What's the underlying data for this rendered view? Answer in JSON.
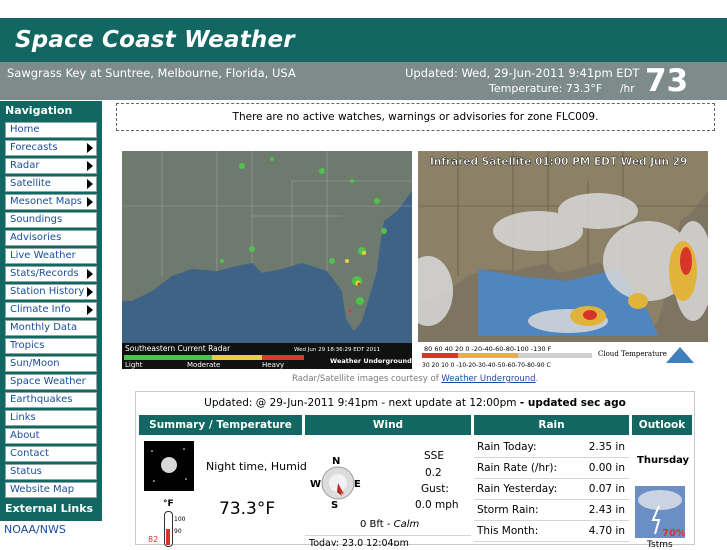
{
  "header": {
    "site_title": "Space Coast Weather",
    "location": "Sawgrass Key at Suntree, Melbourne, Florida, USA",
    "updated": "Updated:  Wed, 29-Jun-2011 9:41pm EDT",
    "temperature_line": "Temperature: 73.3°F",
    "temperature_rate_unit": "/hr",
    "temperature_big": "73 °F"
  },
  "sidebar": {
    "nav_heading": "Navigation",
    "items": [
      {
        "label": "Home",
        "submenu": false
      },
      {
        "label": "Forecasts",
        "submenu": true
      },
      {
        "label": "Radar",
        "submenu": true
      },
      {
        "label": "Satellite",
        "submenu": true
      },
      {
        "label": "Mesonet Maps",
        "submenu": true
      },
      {
        "label": "Soundings",
        "submenu": false
      },
      {
        "label": "Advisories",
        "submenu": false
      },
      {
        "label": "Live Weather",
        "submenu": false
      },
      {
        "label": "Stats/Records",
        "submenu": true
      },
      {
        "label": "Station History",
        "submenu": true
      },
      {
        "label": "Climate Info",
        "submenu": true
      },
      {
        "label": "Monthly Data",
        "submenu": false
      },
      {
        "label": "Tropics",
        "submenu": false
      },
      {
        "label": "Sun/Moon",
        "submenu": false
      },
      {
        "label": "Space Weather",
        "submenu": false
      },
      {
        "label": "Earthquakes",
        "submenu": false
      },
      {
        "label": "Links",
        "submenu": false
      },
      {
        "label": "About",
        "submenu": false
      },
      {
        "label": "Contact",
        "submenu": false
      },
      {
        "label": "Status",
        "submenu": false
      },
      {
        "label": "Website Map",
        "submenu": false
      }
    ],
    "external_heading": "External Links",
    "external_items": [
      "NOAA/NWS"
    ]
  },
  "advisory": "There are no active watches, warnings or advisories for zone FLC009.",
  "radar": {
    "title": "Southeastern Current Radar",
    "timestamp": "Wed Jun 29 18:36:29 EDT 2011",
    "legend": [
      "Light",
      "Moderate",
      "Heavy"
    ],
    "brand": "Weather Underground"
  },
  "satellite": {
    "title": "Infrared Satellite 01:00 PM EDT Wed Jun 29",
    "scale_top": "80  60  40  20   0  -20-40-60-80-100  -130  F",
    "scale_bottom": "30 20 10  0 -10-20-30-40-50-60-70-80-90  C",
    "legend_label": "Cloud Temperature"
  },
  "credit": {
    "prefix": "Radar/Satellite images courtesy of ",
    "link": "Weather Underground",
    "suffix": "."
  },
  "current": {
    "updated_line": "Updated: @ 29-Jun-2011 9:41pm - next update at 12:00pm",
    "updated_suffix": "- updated sec ago",
    "columns": [
      "Summary / Temperature",
      "Wind",
      "Rain",
      "Outlook"
    ],
    "summary": "Night time, Humid",
    "temperature": "73.3°F",
    "thermo_unit": "°F",
    "thermo_ticks": [
      "100",
      "90"
    ],
    "thermo_value": "82",
    "wind": {
      "compass": {
        "n": "N",
        "s": "S",
        "e": "E",
        "w": "W"
      },
      "direction": "SSE",
      "speed": "0.2",
      "gust_label": "Gust:",
      "gust": "0.0 mph",
      "beaufort": "0 Bft -",
      "beaufort_desc": "Calm",
      "today": "Today: 23.0 12:04pm"
    },
    "rain": [
      {
        "label": "Rain Today:",
        "value": "2.35 in"
      },
      {
        "label": "Rain Rate (/hr):",
        "value": "0.00 in"
      },
      {
        "label": "Rain Yesterday:",
        "value": "0.07 in"
      },
      {
        "label": "Storm Rain:",
        "value": "2.43 in"
      },
      {
        "label": "This Month:",
        "value": "4.70 in"
      }
    ],
    "outlook": {
      "day": "Thursday",
      "pop": "70%",
      "caption": "Tstms"
    }
  },
  "colors": {
    "header": "#126762",
    "subheader": "#7d8c8a",
    "link": "#1a4d9c"
  }
}
